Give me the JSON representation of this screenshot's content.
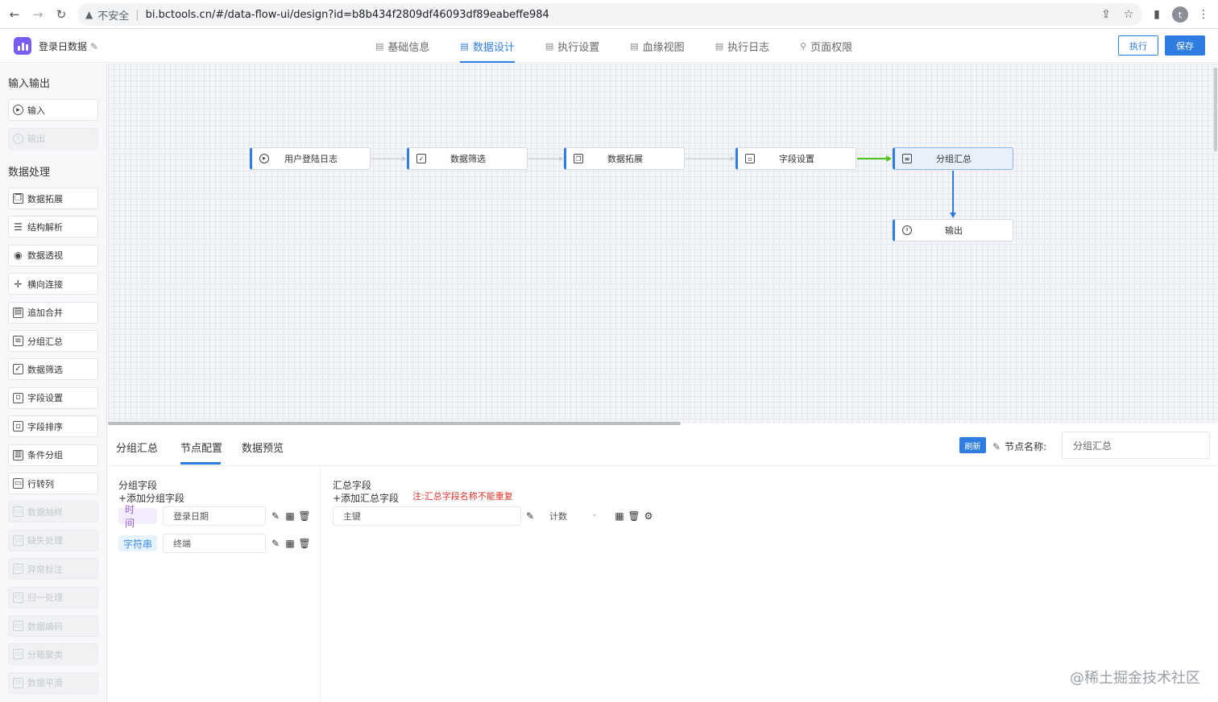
{
  "browser": {
    "security": "不安全",
    "url": "bi.bctools.cn/#/data-flow-ui/design?id=b8b434f2809df46093df89eabeffe984",
    "avatar_letter": "t"
  },
  "app": {
    "title": "登录日数据",
    "tabs": [
      {
        "label": "基础信息"
      },
      {
        "label": "数据设计"
      },
      {
        "label": "执行设置"
      },
      {
        "label": "血缘视图"
      },
      {
        "label": "执行日志"
      },
      {
        "label": "页面权限"
      }
    ],
    "active_tab": "数据设计",
    "exec_label": "执行",
    "save_label": "保存",
    "accent_color": "#2f7de1"
  },
  "sidebar": {
    "section1_title": "输入输出",
    "io_items": [
      {
        "label": "输入",
        "icon": "play-circle-icon",
        "disabled": false
      },
      {
        "label": "输出",
        "icon": "pause-circle-icon",
        "disabled": true
      }
    ],
    "section2_title": "数据处理",
    "proc_items": [
      {
        "label": "数据拓展",
        "icon": "copy-icon",
        "disabled": false
      },
      {
        "label": "结构解析",
        "icon": "sliders-icon",
        "disabled": false
      },
      {
        "label": "数据透视",
        "icon": "eye-icon",
        "disabled": false
      },
      {
        "label": "横向连接",
        "icon": "move-icon",
        "disabled": false
      },
      {
        "label": "追加合并",
        "icon": "calendar-icon",
        "disabled": false
      },
      {
        "label": "分组汇总",
        "icon": "document-icon",
        "disabled": false
      },
      {
        "label": "数据筛选",
        "icon": "file-check-icon",
        "disabled": false
      },
      {
        "label": "字段设置",
        "icon": "file-icon",
        "disabled": false
      },
      {
        "label": "字段排序",
        "icon": "file-icon",
        "disabled": false
      },
      {
        "label": "条件分组",
        "icon": "grid-icon",
        "disabled": false
      },
      {
        "label": "行转列",
        "icon": "window-icon",
        "disabled": false
      },
      {
        "label": "数据抽样",
        "icon": "window-icon",
        "disabled": true
      },
      {
        "label": "缺失处理",
        "icon": "window-icon",
        "disabled": true
      },
      {
        "label": "异常标注",
        "icon": "window-icon",
        "disabled": true
      },
      {
        "label": "归一处理",
        "icon": "window-icon",
        "disabled": true
      },
      {
        "label": "数据编码",
        "icon": "window-icon",
        "disabled": true
      },
      {
        "label": "分箱聚类",
        "icon": "window-icon",
        "disabled": true
      },
      {
        "label": "数据平滑",
        "icon": "window-icon",
        "disabled": true
      }
    ]
  },
  "flow": {
    "nodes": [
      {
        "label": "用户登陆日志",
        "icon": "play-circle-icon"
      },
      {
        "label": "数据筛选",
        "icon": "file-check-icon"
      },
      {
        "label": "数据拓展",
        "icon": "copy-icon"
      },
      {
        "label": "字段设置",
        "icon": "file-icon"
      },
      {
        "label": "分组汇总",
        "icon": "document-icon",
        "selected": true
      },
      {
        "label": "输出",
        "icon": "pause-circle-icon"
      }
    ],
    "active_edge_colors": {
      "green": "#52c41a",
      "blue": "#2f7de1"
    }
  },
  "bottom": {
    "tabs": [
      {
        "label": "分组汇总"
      },
      {
        "label": "节点配置"
      },
      {
        "label": "数据预览"
      }
    ],
    "active_tab": "节点配置",
    "refresh_label": "刷新",
    "node_name_label": "节点名称:",
    "node_name_value": "分组汇总",
    "group": {
      "title": "分组字段",
      "add_label": "+添加分组字段",
      "rows": [
        {
          "type": "时间",
          "field": "登录日期"
        },
        {
          "type": "字符串",
          "field": "终端"
        }
      ]
    },
    "summary": {
      "title": "汇总字段",
      "add_label": "+添加汇总字段",
      "note": "注:汇总字段名称不能重复",
      "rows": [
        {
          "field": "主键",
          "agg": "计数"
        }
      ]
    }
  },
  "watermark": "@稀土掘金技术社区"
}
